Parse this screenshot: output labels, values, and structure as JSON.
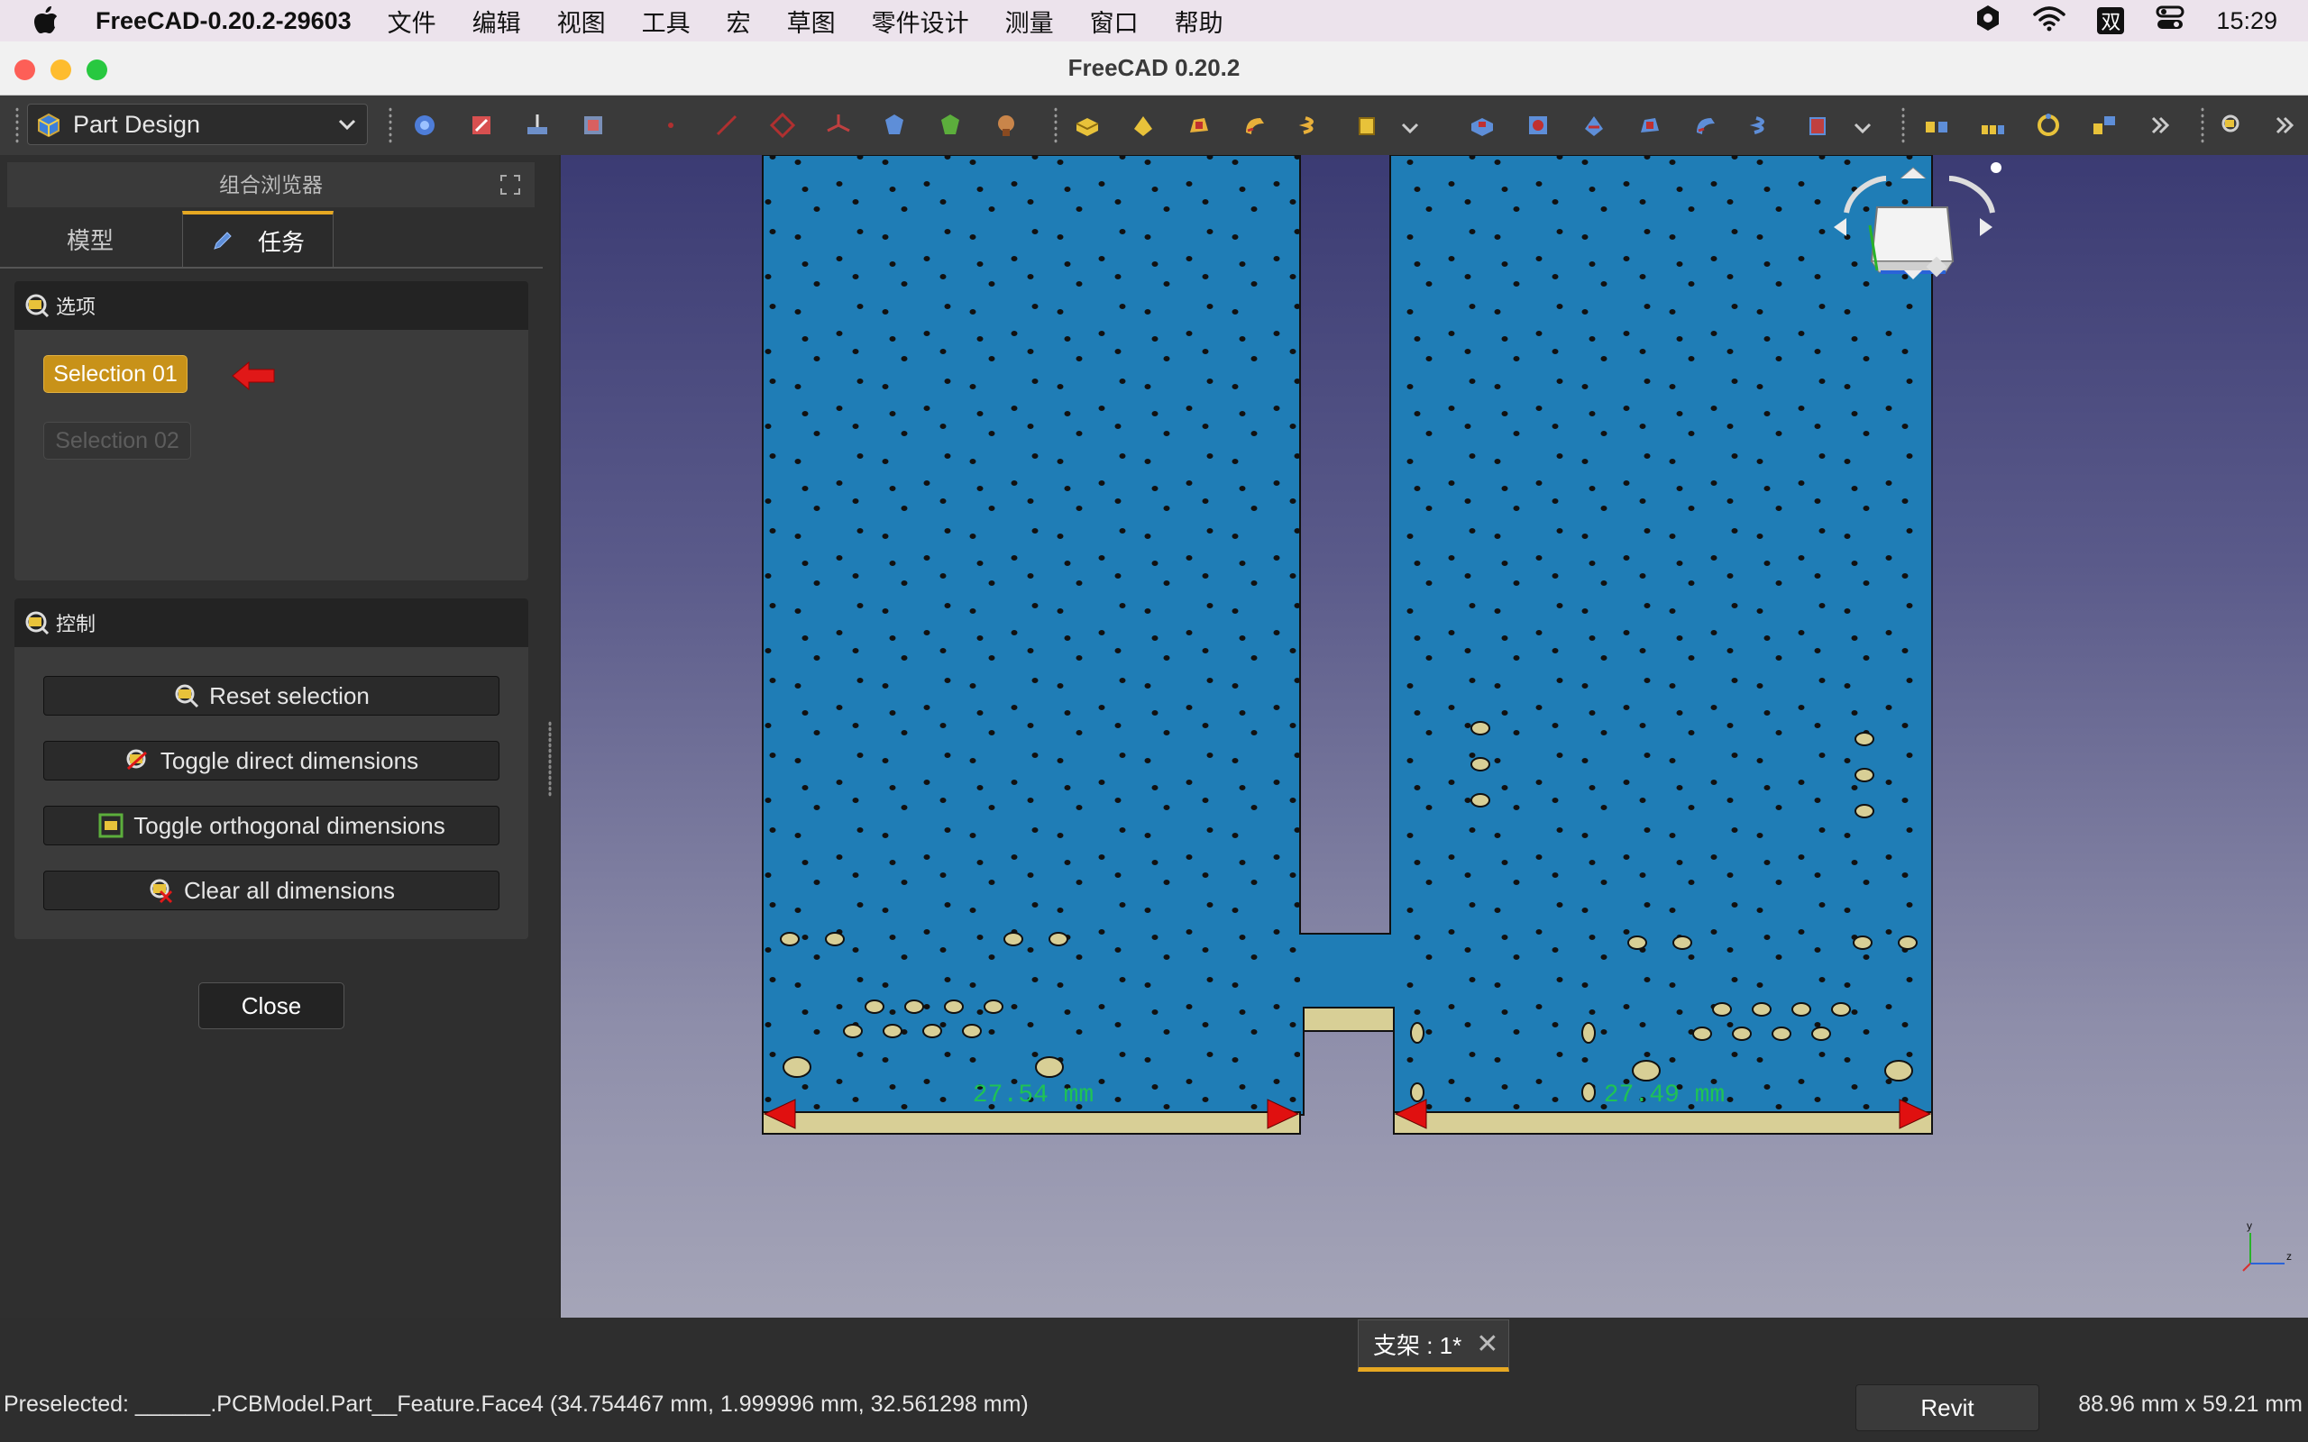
{
  "menubar": {
    "app_name": "FreeCAD-0.20.2-29603",
    "items": [
      "文件",
      "编辑",
      "视图",
      "工具",
      "宏",
      "草图",
      "零件设计",
      "测量",
      "窗口",
      "帮助"
    ],
    "input_method": "双",
    "clock": "15:29"
  },
  "window": {
    "title": "FreeCAD 0.20.2"
  },
  "toolbar": {
    "workbench": "Part Design"
  },
  "panel": {
    "header": "组合浏览器",
    "tabs": [
      "模型",
      "任务"
    ],
    "options_title": "选项",
    "selection1": "Selection 01",
    "selection2": "Selection 02",
    "control_title": "控制",
    "buttons": [
      "Reset selection",
      "Toggle direct dimensions",
      "Toggle orthogonal dimensions",
      "Clear all dimensions"
    ],
    "close": "Close"
  },
  "viewport": {
    "dim_left": "27.54 mm",
    "dim_right": "27.49 mm",
    "axis_y": "y",
    "axis_z": "z"
  },
  "document_tab": {
    "label": "支架 : 1*"
  },
  "statusbar": {
    "preselected": "Preselected: ______.PCBModel.Part__Feature.Face4 (34.754467 mm, 1.999996 mm, 32.561298 mm)",
    "nav_style": "Revit",
    "dimensions": "88.96 mm x 59.21 mm"
  },
  "colors": {
    "accent": "#e6a822",
    "board": "#1f7db6",
    "pad": "#d8cf96",
    "dim_text": "#1fc256",
    "arrow": "#e01010"
  }
}
